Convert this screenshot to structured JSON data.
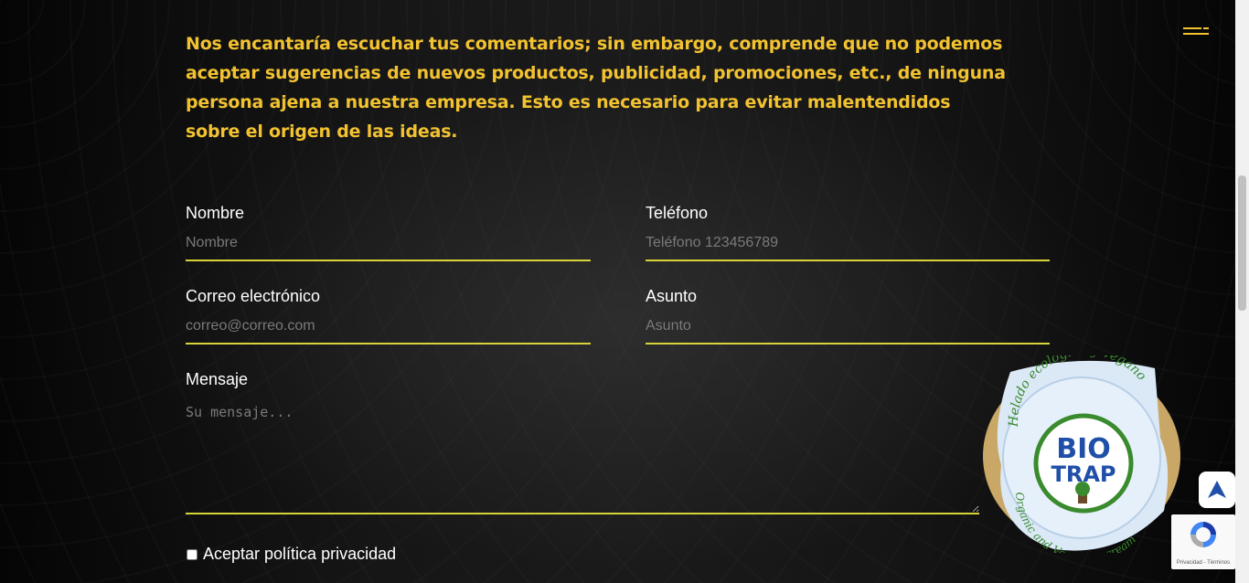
{
  "intro": {
    "text": "Nos encantaría escuchar tus comentarios; sin embargo, comprende que no podemos aceptar sugerencias de nuevos productos, publicidad, promociones, etc., de ninguna persona ajena a nuestra empresa. Esto es necesario para evitar malentendidos sobre el origen de las ideas."
  },
  "form": {
    "nombre": {
      "label": "Nombre",
      "placeholder": "Nombre"
    },
    "telefono": {
      "label": "Teléfono",
      "placeholder": "Teléfono 123456789"
    },
    "correo": {
      "label": "Correo electrónico",
      "placeholder": "correo@correo.com"
    },
    "asunto": {
      "label": "Asunto",
      "placeholder": "Asunto"
    },
    "mensaje": {
      "label": "Mensaje",
      "placeholder": "Su mensaje..."
    },
    "privacy_label": "Aceptar política privacidad"
  },
  "product": {
    "brand_line1": "BIO",
    "brand_line2": "TRAP",
    "arc_top": "Helado ecológico y vegano",
    "arc_bottom": "Organic and Vegan ice cream"
  },
  "recaptcha": {
    "links": "Privacidad - Términos"
  },
  "colors": {
    "accent_yellow": "#f2c230",
    "underline": "#d7d33a",
    "brand_blue": "#1f4fa8",
    "brand_green": "#3a8a2e"
  },
  "icons": {
    "menu": "menu-lines-icon",
    "scroll_top": "arrow-up-icon",
    "recaptcha": "recaptcha-icon"
  }
}
